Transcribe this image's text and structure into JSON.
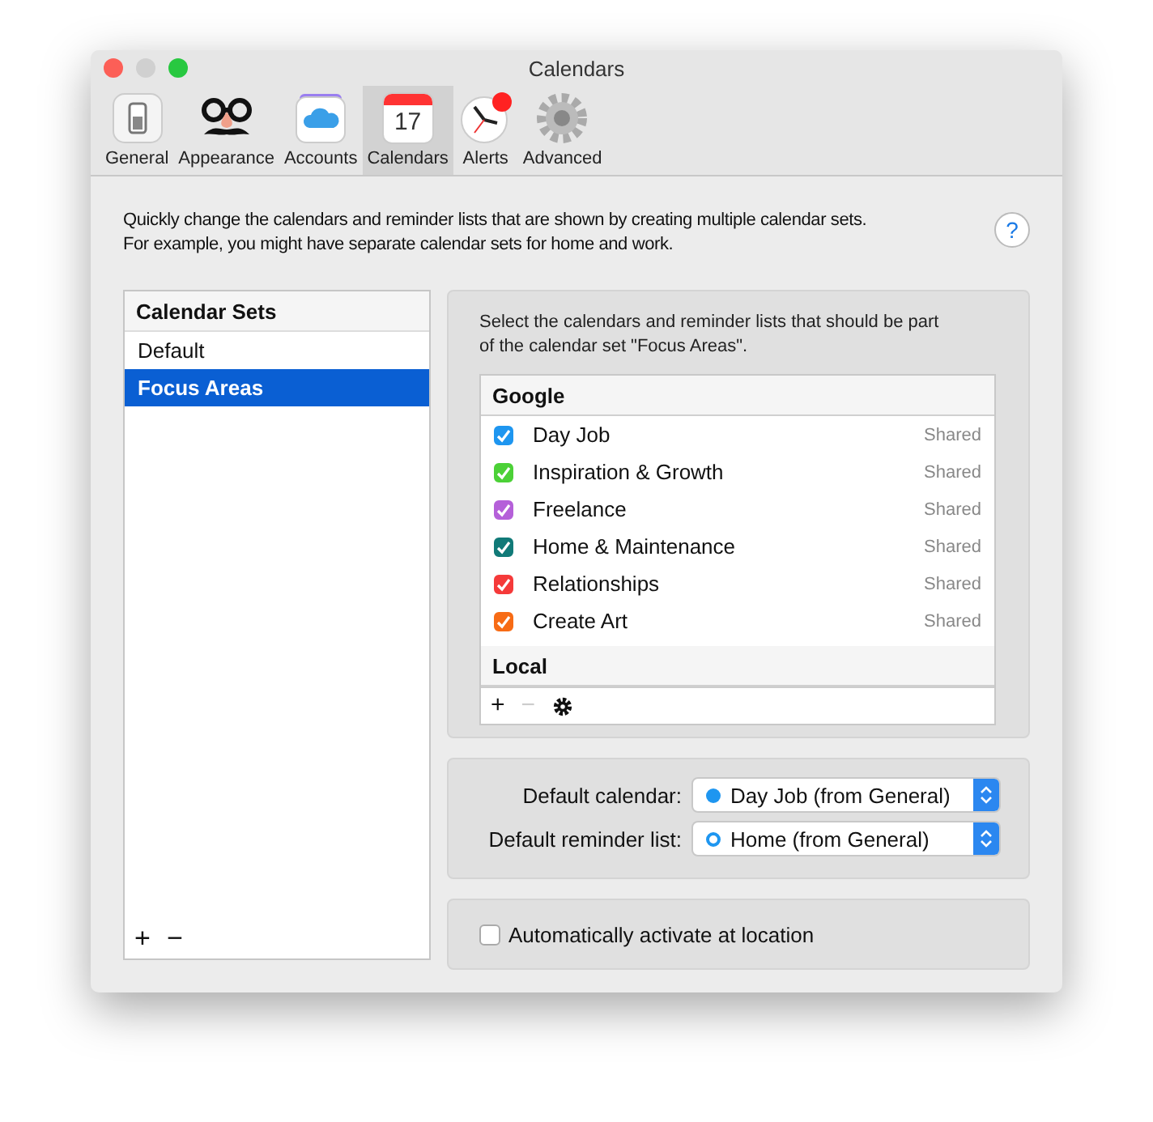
{
  "window": {
    "title": "Calendars"
  },
  "toolbar": [
    {
      "label": "General",
      "kind": "switch",
      "selected": false
    },
    {
      "label": "Appearance",
      "kind": "disguise",
      "selected": false
    },
    {
      "label": "Accounts",
      "kind": "cloud",
      "selected": false
    },
    {
      "label": "Calendars",
      "kind": "calendar",
      "selected": true,
      "icon_text": "17"
    },
    {
      "label": "Alerts",
      "kind": "clock",
      "selected": false
    },
    {
      "label": "Advanced",
      "kind": "gear",
      "selected": false
    }
  ],
  "intro": "Quickly change the calendars and reminder lists that are shown by creating multiple calendar sets.\nFor example, you might have separate calendar sets for home and work.",
  "help_button": "?",
  "calendar_sets": {
    "header": "Calendar Sets",
    "items": [
      {
        "label": "Default",
        "selected": false
      },
      {
        "label": "Focus Areas",
        "selected": true
      }
    ],
    "add": "+",
    "remove": "−"
  },
  "selection_text": "Select the calendars and reminder lists that should be part\nof the calendar set \"Focus Areas\".",
  "groups": [
    {
      "name": "Google",
      "calendars": [
        {
          "label": "Day Job",
          "color": "#1e96f0",
          "checked": true,
          "note": "Shared"
        },
        {
          "label": "Inspiration & Growth",
          "color": "#4cd137",
          "checked": true,
          "note": "Shared"
        },
        {
          "label": "Freelance",
          "color": "#b560d9",
          "checked": true,
          "note": "Shared"
        },
        {
          "label": "Home & Maintenance",
          "color": "#117a78",
          "checked": true,
          "note": "Shared"
        },
        {
          "label": "Relationships",
          "color": "#f53a3a",
          "checked": true,
          "note": "Shared"
        },
        {
          "label": "Create Art",
          "color": "#f76b15",
          "checked": true,
          "note": "Shared"
        }
      ]
    },
    {
      "name": "Local"
    }
  ],
  "list_buttons": {
    "add": "+",
    "remove": "−",
    "remove_disabled": true
  },
  "defaults": [
    {
      "label": "Default calendar:",
      "value": "Day Job (from General)",
      "kind": "filled"
    },
    {
      "label": "Default reminder list:",
      "value": "Home (from General)",
      "kind": "ring"
    }
  ],
  "location": {
    "label": "Automatically activate at location",
    "checked": false
  }
}
